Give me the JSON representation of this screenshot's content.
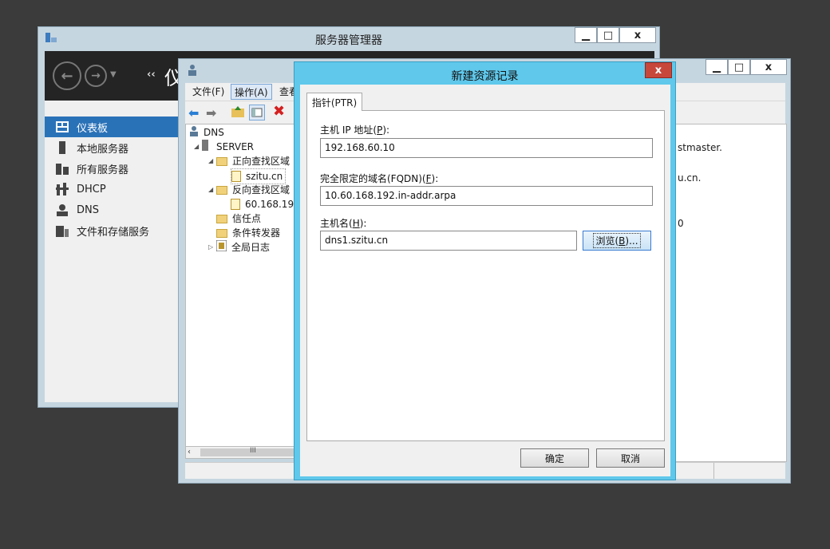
{
  "server_manager": {
    "title": "服务器管理器",
    "nav_title_partial": "仪",
    "sidebar": [
      {
        "label": "仪表板",
        "icon": "dashboard-icon",
        "active": true
      },
      {
        "label": "本地服务器",
        "icon": "server-icon"
      },
      {
        "label": "所有服务器",
        "icon": "servers-icon"
      },
      {
        "label": "DHCP",
        "icon": "dhcp-icon"
      },
      {
        "label": "DNS",
        "icon": "dns-icon"
      },
      {
        "label": "文件和存储服务",
        "icon": "storage-icon"
      }
    ]
  },
  "dns_manager": {
    "menu": {
      "file": "文件(F)",
      "action": "操作(A)",
      "view_partial": "查看"
    },
    "tree": {
      "root": "DNS",
      "server": "SERVER",
      "forward_zones": "正向查找区域",
      "forward_zone_item": "szitu.cn",
      "reverse_zones": "反向查找区域",
      "reverse_zone_item": "60.168.19",
      "trust_points": "信任点",
      "conditional_forwarders": "条件转发器",
      "global_logs": "全局日志"
    },
    "right_pane": {
      "line1": "stmaster.",
      "line2": "u.cn.",
      "line3": "0"
    },
    "hscroll_grip": "III"
  },
  "dialog": {
    "title": "新建资源记录",
    "tab": "指针(PTR)",
    "host_ip": {
      "label": "主机 IP 地址(",
      "accel": "P",
      "suffix": "):",
      "value": "192.168.60.10"
    },
    "fqdn": {
      "label": "完全限定的域名(FQDN)(",
      "accel": "F",
      "suffix": "):",
      "value": "10.60.168.192.in-addr.arpa"
    },
    "host_name": {
      "label": "主机名(",
      "accel": "H",
      "suffix": "):",
      "value": "dns1.szitu.cn"
    },
    "browse": {
      "label": "浏览(",
      "accel": "B",
      "suffix": ")..."
    },
    "ok": "确定",
    "cancel": "取消",
    "close": "x"
  },
  "window_controls": {
    "minimize": "▁",
    "maximize": "□",
    "close": "x"
  },
  "colors": {
    "dialog_frame": "#5fc8eb",
    "close_red": "#c8473b",
    "sidebar_active": "#2a72b8",
    "window_frame": "#c6d6e0"
  }
}
